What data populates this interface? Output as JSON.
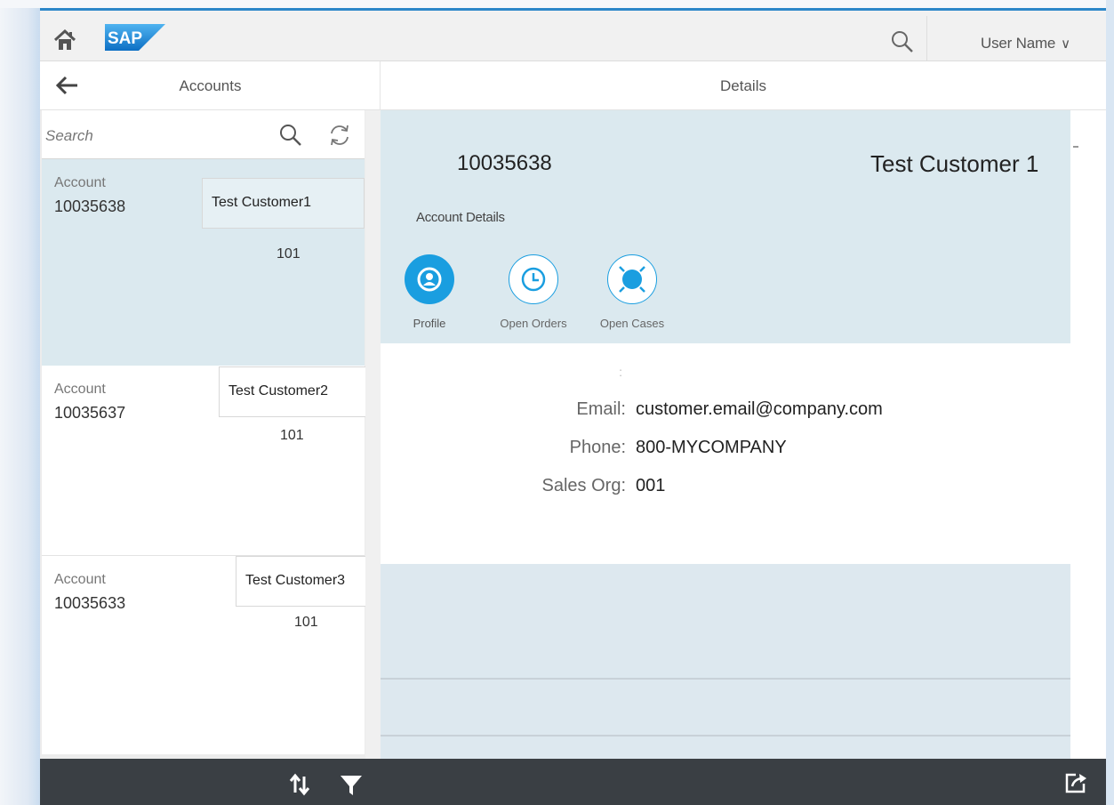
{
  "shell": {
    "logo_text": "SAP",
    "user_name": "User Name",
    "icons": {
      "home": "home-icon",
      "search": "search-icon",
      "chevron": "chevron-down-icon"
    }
  },
  "master": {
    "title": "Accounts",
    "search": {
      "placeholder": "Search",
      "value": ""
    },
    "items": [
      {
        "account_label": "Account",
        "account_number": "10035638",
        "customer": "Test Customer1",
        "qty": "101",
        "selected": true
      },
      {
        "account_label": "Account",
        "account_number": "10035637",
        "customer": "Test Customer2",
        "qty": "101",
        "selected": false
      },
      {
        "account_label": "Account",
        "account_number": "10035633",
        "customer": "Test Customer3",
        "qty": "101",
        "selected": false
      }
    ]
  },
  "detail": {
    "title": "Details",
    "object": {
      "number": "10035638",
      "title": "Test Customer 1"
    },
    "section_label": "Account Details",
    "tabs": [
      {
        "label": "Profile",
        "icon": "person-icon",
        "selected": true
      },
      {
        "label": "Open Orders",
        "icon": "clock-icon",
        "selected": false
      },
      {
        "label": "Open Cases",
        "icon": "lifebuoy-icon",
        "selected": false
      }
    ],
    "form": {
      "blank_label": ":",
      "email_label": "Email:",
      "email_value": "customer.email@company.com",
      "phone_label": "Phone:",
      "phone_value": "800-MYCOMPANY",
      "sales_org_label": "Sales Org:",
      "sales_org_value": "001"
    }
  },
  "footer": {
    "icons": [
      "sort-icon",
      "filter-icon",
      "share-icon"
    ]
  },
  "colors": {
    "accent": "#1a9ee0",
    "shell_bar": "#2b86c9",
    "footer": "#3a3f44",
    "object_header": "#dbe9ef"
  }
}
